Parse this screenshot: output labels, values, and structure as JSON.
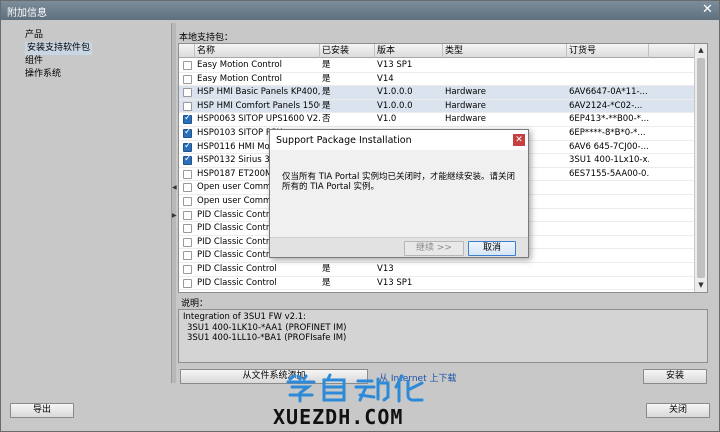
{
  "window": {
    "title": "附加信息",
    "close_glyph": "✕"
  },
  "sidebar": {
    "items": [
      {
        "label": "产品",
        "selected": false
      },
      {
        "label": "安装支持软件包",
        "selected": true
      },
      {
        "label": "组件",
        "selected": false
      },
      {
        "label": "操作系统",
        "selected": false
      }
    ]
  },
  "packages": {
    "section_label": "本地支持包：",
    "columns": [
      "名称",
      "已安装",
      "版本",
      "类型",
      "订货号"
    ],
    "rows": [
      {
        "checked": false,
        "name": "Easy Motion Control",
        "installed": "是",
        "version": "V13 SP1",
        "type": "",
        "order": ""
      },
      {
        "checked": false,
        "name": "Easy Motion Control",
        "installed": "是",
        "version": "V14",
        "type": "",
        "order": ""
      },
      {
        "checked": false,
        "name": "HSP HMI Basic Panels KP400, ...",
        "installed": "是",
        "version": "V1.0.0.0",
        "type": "Hardware",
        "order": "6AV6647-0A*11-..."
      },
      {
        "checked": false,
        "name": "HSP HMI Comfort Panels 1500...",
        "installed": "是",
        "version": "V1.0.0.0",
        "type": "Hardware",
        "order": "6AV2124-*C02-..."
      },
      {
        "checked": true,
        "name": "HSP0063 SITOP UPS1600 V2.3",
        "installed": "否",
        "version": "V1.0",
        "type": "Hardware",
        "order": "6EP413*-**B00-*..."
      },
      {
        "checked": true,
        "name": "HSP0103 SITOP PSU",
        "installed": "",
        "version": "",
        "type": "",
        "order": "6EP****-8*B*0-*..."
      },
      {
        "checked": true,
        "name": "HSP0116 HMI Mobil",
        "installed": "",
        "version": "",
        "type": "",
        "order": "6AV6 645-7CJ00-..."
      },
      {
        "checked": true,
        "name": "HSP0132 Sirius 3SU",
        "installed": "",
        "version": "",
        "type": "",
        "order": "3SU1 400-1Lx10-x..."
      },
      {
        "checked": false,
        "name": "HSP0187 ET200MP",
        "installed": "",
        "version": "",
        "type": "",
        "order": "6ES7155-5AA00-0..."
      },
      {
        "checked": false,
        "name": "Open user Commu",
        "installed": "",
        "version": "",
        "type": "",
        "order": ""
      },
      {
        "checked": false,
        "name": "Open user Commu",
        "installed": "",
        "version": "",
        "type": "",
        "order": ""
      },
      {
        "checked": false,
        "name": "PID Classic Control",
        "installed": "",
        "version": "",
        "type": "",
        "order": ""
      },
      {
        "checked": false,
        "name": "PID Classic Control",
        "installed": "",
        "version": "",
        "type": "",
        "order": ""
      },
      {
        "checked": false,
        "name": "PID Classic Control",
        "installed": "",
        "version": "",
        "type": "",
        "order": ""
      },
      {
        "checked": false,
        "name": "PID Classic Control",
        "installed": "",
        "version": "",
        "type": "",
        "order": ""
      },
      {
        "checked": false,
        "name": "PID Classic Control",
        "installed": "是",
        "version": "V13",
        "type": "",
        "order": ""
      },
      {
        "checked": false,
        "name": "PID Classic Control",
        "installed": "是",
        "version": "V13 SP1",
        "type": "",
        "order": ""
      }
    ]
  },
  "description": {
    "label": "说明：",
    "lines": [
      "Integration of 3SU1 FW v2.1:",
      "3SU1 400-1LK10-*AA1 (PROFINET IM)",
      "3SU1 400-1LL10-*BA1 (PROFIsafe IM)"
    ]
  },
  "actions": {
    "add_from_fs": "从文件系统添加",
    "internet_link": "从 Internet 上下载",
    "install": "安装",
    "export": "导出",
    "close": "关闭"
  },
  "dialog": {
    "title": "Support Package Installation",
    "message": "仅当所有 TIA Portal 实例均已关闭时，才能继续安装。请关闭所有的 TIA Portal 实例。",
    "continue": "继续 >>",
    "cancel": "取消"
  },
  "watermark": {
    "cn": "学自动化",
    "en": "XUEZDH.COM"
  }
}
